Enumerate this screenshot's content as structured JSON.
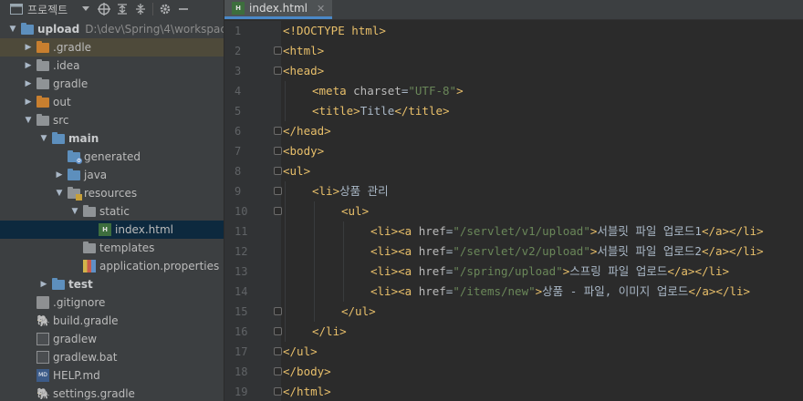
{
  "project_panel": {
    "title": "프로젝트",
    "toolbar_icons": [
      "project-view-icon",
      "dropdown-arrow-icon",
      "locate-icon",
      "expand-all-icon",
      "collapse-all-icon",
      "settings-gear-icon",
      "hide-panel-icon"
    ]
  },
  "tree": [
    {
      "label": "upload",
      "hint": "D:\\dev\\Spring\\4\\workspac",
      "depth": 0,
      "expanded": true,
      "icon": "module-folder-icon",
      "bold": true
    },
    {
      "label": ".gradle",
      "depth": 1,
      "expanded": false,
      "icon": "excluded-folder-icon",
      "highlight": "gradle"
    },
    {
      "label": ".idea",
      "depth": 1,
      "expanded": false,
      "icon": "folder-icon"
    },
    {
      "label": "gradle",
      "depth": 1,
      "expanded": false,
      "icon": "folder-icon"
    },
    {
      "label": "out",
      "depth": 1,
      "expanded": false,
      "icon": "excluded-folder-icon"
    },
    {
      "label": "src",
      "depth": 1,
      "expanded": true,
      "icon": "folder-icon"
    },
    {
      "label": "main",
      "depth": 2,
      "expanded": true,
      "icon": "source-set-folder-icon",
      "bold": true
    },
    {
      "label": "generated",
      "depth": 3,
      "icon": "generated-folder-icon"
    },
    {
      "label": "java",
      "depth": 3,
      "expanded": false,
      "icon": "source-folder-icon"
    },
    {
      "label": "resources",
      "depth": 3,
      "expanded": true,
      "icon": "resources-folder-icon"
    },
    {
      "label": "static",
      "depth": 4,
      "expanded": true,
      "icon": "folder-icon"
    },
    {
      "label": "index.html",
      "depth": 5,
      "icon": "html-file-icon",
      "selected": true
    },
    {
      "label": "templates",
      "depth": 4,
      "icon": "folder-icon"
    },
    {
      "label": "application.properties",
      "depth": 4,
      "icon": "properties-file-icon"
    },
    {
      "label": "test",
      "depth": 2,
      "expanded": false,
      "icon": "source-set-folder-icon",
      "bold": true
    },
    {
      "label": ".gitignore",
      "depth": 1,
      "icon": "gitignore-file-icon"
    },
    {
      "label": "build.gradle",
      "depth": 1,
      "icon": "gradle-file-icon"
    },
    {
      "label": "gradlew",
      "depth": 1,
      "icon": "terminal-file-icon"
    },
    {
      "label": "gradlew.bat",
      "depth": 1,
      "icon": "bat-file-icon"
    },
    {
      "label": "HELP.md",
      "depth": 1,
      "icon": "markdown-file-icon"
    },
    {
      "label": "settings.gradle",
      "depth": 1,
      "icon": "gradle-file-icon"
    }
  ],
  "editor": {
    "tab": {
      "label": "index.html",
      "icon": "html-file-icon"
    },
    "lines": [
      {
        "n": "1",
        "indent": 0,
        "fold": false,
        "tokens": [
          [
            "doc",
            "<!DOCTYPE html>"
          ]
        ]
      },
      {
        "n": "2",
        "indent": 0,
        "fold": true,
        "tokens": [
          [
            "tag",
            "<html>"
          ]
        ]
      },
      {
        "n": "3",
        "indent": 0,
        "fold": true,
        "tokens": [
          [
            "tag",
            "<head>"
          ]
        ]
      },
      {
        "n": "4",
        "indent": 1,
        "fold": false,
        "tokens": [
          [
            "tag",
            "<meta "
          ],
          [
            "attr",
            "charset"
          ],
          [
            "text",
            "="
          ],
          [
            "val",
            "\"UTF-8\""
          ],
          [
            "tag",
            ">"
          ]
        ]
      },
      {
        "n": "5",
        "indent": 1,
        "fold": false,
        "tokens": [
          [
            "tag",
            "<title>"
          ],
          [
            "text",
            "Title"
          ],
          [
            "tag",
            "</title>"
          ]
        ]
      },
      {
        "n": "6",
        "indent": 0,
        "fold": true,
        "tokens": [
          [
            "tag",
            "</head>"
          ]
        ]
      },
      {
        "n": "7",
        "indent": 0,
        "fold": true,
        "tokens": [
          [
            "tag",
            "<body>"
          ]
        ]
      },
      {
        "n": "8",
        "indent": 0,
        "fold": true,
        "tokens": [
          [
            "tag",
            "<ul>"
          ]
        ]
      },
      {
        "n": "9",
        "indent": 1,
        "fold": true,
        "tokens": [
          [
            "tag",
            "<li>"
          ],
          [
            "text",
            "상품 관리"
          ]
        ]
      },
      {
        "n": "10",
        "indent": 2,
        "fold": true,
        "tokens": [
          [
            "tag",
            "<ul>"
          ]
        ]
      },
      {
        "n": "11",
        "indent": 3,
        "fold": false,
        "tokens": [
          [
            "tag",
            "<li><a "
          ],
          [
            "attr",
            "href"
          ],
          [
            "text",
            "="
          ],
          [
            "val",
            "\"/servlet/v1/upload\""
          ],
          [
            "tag",
            ">"
          ],
          [
            "text",
            "서블릿 파일 업로드1"
          ],
          [
            "tag",
            "</a></li>"
          ]
        ]
      },
      {
        "n": "12",
        "indent": 3,
        "fold": false,
        "tokens": [
          [
            "tag",
            "<li><a "
          ],
          [
            "attr",
            "href"
          ],
          [
            "text",
            "="
          ],
          [
            "val",
            "\"/servlet/v2/upload\""
          ],
          [
            "tag",
            ">"
          ],
          [
            "text",
            "서블릿 파일 업로드2"
          ],
          [
            "tag",
            "</a></li>"
          ]
        ]
      },
      {
        "n": "13",
        "indent": 3,
        "fold": false,
        "tokens": [
          [
            "tag",
            "<li><a "
          ],
          [
            "attr",
            "href"
          ],
          [
            "text",
            "="
          ],
          [
            "val",
            "\"/spring/upload\""
          ],
          [
            "tag",
            ">"
          ],
          [
            "text",
            "스프링 파일 업로드"
          ],
          [
            "tag",
            "</a></li>"
          ]
        ]
      },
      {
        "n": "14",
        "indent": 3,
        "fold": false,
        "tokens": [
          [
            "tag",
            "<li><a "
          ],
          [
            "attr",
            "href"
          ],
          [
            "text",
            "="
          ],
          [
            "val",
            "\"/items/new\""
          ],
          [
            "tag",
            ">"
          ],
          [
            "text",
            "상품 - 파일, 이미지 업로드"
          ],
          [
            "tag",
            "</a></li>"
          ]
        ]
      },
      {
        "n": "15",
        "indent": 2,
        "fold": true,
        "tokens": [
          [
            "tag",
            "</ul>"
          ]
        ]
      },
      {
        "n": "16",
        "indent": 1,
        "fold": true,
        "tokens": [
          [
            "tag",
            "</li>"
          ]
        ]
      },
      {
        "n": "17",
        "indent": 0,
        "fold": true,
        "tokens": [
          [
            "tag",
            "</ul>"
          ]
        ]
      },
      {
        "n": "18",
        "indent": 0,
        "fold": true,
        "tokens": [
          [
            "tag",
            "</body>"
          ]
        ]
      },
      {
        "n": "19",
        "indent": 0,
        "fold": true,
        "tokens": [
          [
            "tag",
            "</html>"
          ]
        ]
      }
    ]
  },
  "colors": {
    "tag": "#e8bf6a",
    "attr": "#bababa",
    "value": "#6a8759",
    "text": "#a9b7c6",
    "selection": "#0d293e",
    "tab_underline": "#4a88c7"
  }
}
